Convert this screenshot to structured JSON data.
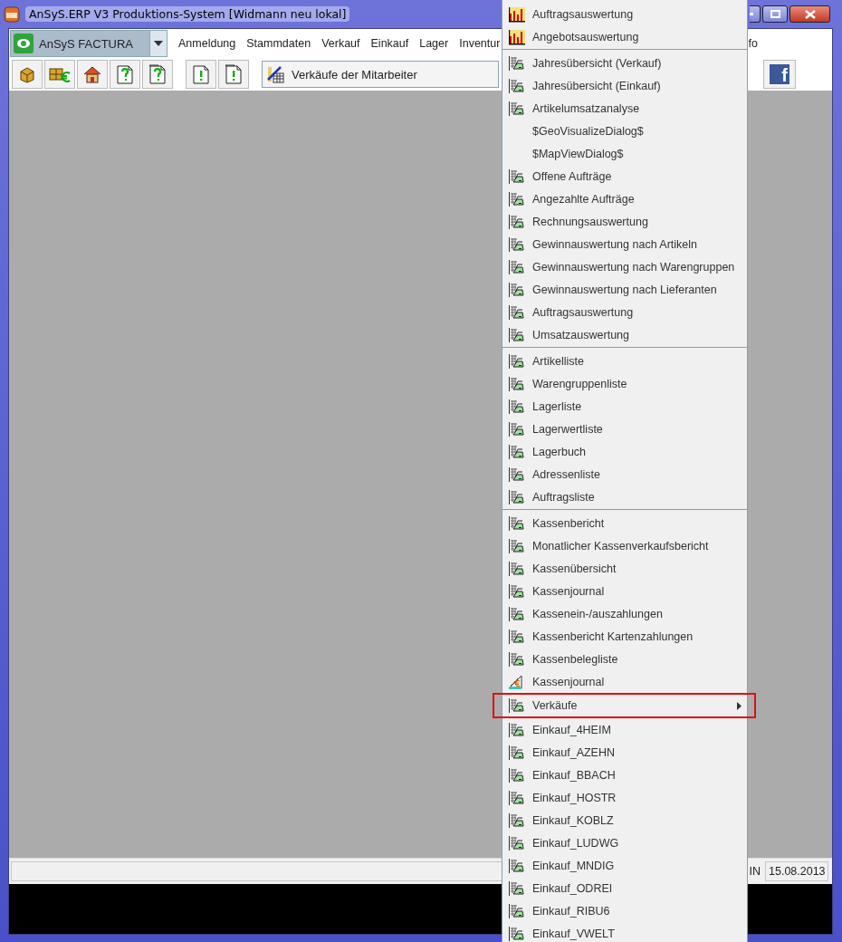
{
  "window": {
    "title": "AnSyS.ERP V3 Produktions-System [Widmann neu lokal]"
  },
  "module_selector": {
    "value": "AnSyS FACTURA"
  },
  "menu_bar": [
    {
      "label": "Anmeldung"
    },
    {
      "label": "Stammdaten"
    },
    {
      "label": "Verkauf"
    },
    {
      "label": "Einkauf"
    },
    {
      "label": "Lager"
    },
    {
      "label": "Inventur"
    },
    {
      "label": "fo"
    }
  ],
  "report_selector": {
    "value": "Verkäufe der Mitarbeiter"
  },
  "social_button": {
    "label": "f"
  },
  "status_bar": {
    "user": "IN",
    "date": "15.08.2013"
  },
  "popup_menu": {
    "sections": [
      [
        {
          "label": "Auftragsauswertung",
          "kind": "chart",
          "submenu": false,
          "marked": false
        },
        {
          "label": "Angebotsauswertung",
          "kind": "chart",
          "submenu": false,
          "marked": false
        }
      ],
      [
        {
          "label": "Jahresübersicht (Verkauf)",
          "kind": "report",
          "submenu": false,
          "marked": false
        },
        {
          "label": "Jahresübersicht (Einkauf)",
          "kind": "report",
          "submenu": false,
          "marked": false
        },
        {
          "label": "Artikelumsatzanalyse",
          "kind": "report",
          "submenu": false,
          "marked": false
        },
        {
          "label": "$GeoVisualizeDialog$",
          "kind": "plain",
          "submenu": false,
          "marked": false
        },
        {
          "label": "$MapViewDialog$",
          "kind": "plain",
          "submenu": false,
          "marked": false
        },
        {
          "label": "Offene Aufträge",
          "kind": "report",
          "submenu": false,
          "marked": false
        },
        {
          "label": "Angezahlte Aufträge",
          "kind": "report",
          "submenu": false,
          "marked": false
        },
        {
          "label": "Rechnungsauswertung",
          "kind": "report",
          "submenu": false,
          "marked": false
        },
        {
          "label": "Gewinnauswertung nach Artikeln",
          "kind": "report",
          "submenu": false,
          "marked": false
        },
        {
          "label": "Gewinnauswertung nach Warengruppen",
          "kind": "report",
          "submenu": false,
          "marked": false
        },
        {
          "label": "Gewinnauswertung nach Lieferanten",
          "kind": "report",
          "submenu": false,
          "marked": false
        },
        {
          "label": "Auftragsauswertung",
          "kind": "report",
          "submenu": false,
          "marked": false
        },
        {
          "label": "Umsatzauswertung",
          "kind": "report",
          "submenu": false,
          "marked": false
        }
      ],
      [
        {
          "label": "Artikelliste",
          "kind": "report",
          "submenu": false,
          "marked": false
        },
        {
          "label": "Warengruppenliste",
          "kind": "report",
          "submenu": false,
          "marked": false
        },
        {
          "label": "Lagerliste",
          "kind": "report",
          "submenu": false,
          "marked": false
        },
        {
          "label": "Lagerwertliste",
          "kind": "report",
          "submenu": false,
          "marked": false
        },
        {
          "label": "Lagerbuch",
          "kind": "report",
          "submenu": false,
          "marked": false
        },
        {
          "label": "Adressenliste",
          "kind": "report",
          "submenu": false,
          "marked": false
        },
        {
          "label": "Auftragsliste",
          "kind": "report",
          "submenu": false,
          "marked": false
        }
      ],
      [
        {
          "label": "Kassenbericht",
          "kind": "report",
          "submenu": false,
          "marked": false
        },
        {
          "label": "Monatlicher Kassenverkaufsbericht",
          "kind": "report",
          "submenu": false,
          "marked": false
        },
        {
          "label": "Kassenübersicht",
          "kind": "report",
          "submenu": false,
          "marked": false
        },
        {
          "label": "Kassenjournal",
          "kind": "report",
          "submenu": false,
          "marked": false
        },
        {
          "label": "Kassenein-/auszahlungen",
          "kind": "report",
          "submenu": false,
          "marked": false
        },
        {
          "label": "Kassenbericht Kartenzahlungen",
          "kind": "report",
          "submenu": false,
          "marked": false
        },
        {
          "label": "Kassenbelegliste",
          "kind": "report",
          "submenu": false,
          "marked": false
        },
        {
          "label": "Kassenjournal",
          "kind": "cash",
          "submenu": false,
          "marked": false
        },
        {
          "label": "Verkäufe",
          "kind": "report",
          "submenu": true,
          "marked": true
        },
        {
          "label": "Einkauf_4HEIM",
          "kind": "report",
          "submenu": false,
          "marked": false
        },
        {
          "label": "Einkauf_AZEHN",
          "kind": "report",
          "submenu": false,
          "marked": false
        },
        {
          "label": "Einkauf_BBACH",
          "kind": "report",
          "submenu": false,
          "marked": false
        },
        {
          "label": "Einkauf_HOSTR",
          "kind": "report",
          "submenu": false,
          "marked": false
        },
        {
          "label": "Einkauf_KOBLZ",
          "kind": "report",
          "submenu": false,
          "marked": false
        },
        {
          "label": "Einkauf_LUDWG",
          "kind": "report",
          "submenu": false,
          "marked": false
        },
        {
          "label": "Einkauf_MNDIG",
          "kind": "report",
          "submenu": false,
          "marked": false
        },
        {
          "label": "Einkauf_ODREI",
          "kind": "report",
          "submenu": false,
          "marked": false
        },
        {
          "label": "Einkauf_RIBU6",
          "kind": "report",
          "submenu": false,
          "marked": false
        },
        {
          "label": "Einkauf_VWELT",
          "kind": "report",
          "submenu": false,
          "marked": false
        }
      ]
    ]
  }
}
